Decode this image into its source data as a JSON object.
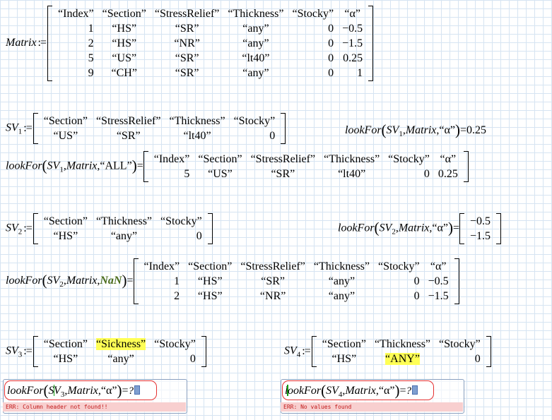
{
  "matrix_def": {
    "name": "Matrix",
    "rows": [
      [
        "“Index”",
        "“Section”",
        "“StressRelief”",
        "“Thickness”",
        "“Stocky”",
        "“α”"
      ],
      [
        "1",
        "“HS”",
        "“SR”",
        "“any”",
        "0",
        "−0.5"
      ],
      [
        "2",
        "“HS”",
        "“NR”",
        "“any”",
        "0",
        "−1.5"
      ],
      [
        "5",
        "“US”",
        "“SR”",
        "“lt40”",
        "0",
        "0.25"
      ],
      [
        "9",
        "“CH”",
        "“SR”",
        "“any”",
        "0",
        "1"
      ]
    ]
  },
  "sv1": {
    "name": "SV",
    "sub": "1",
    "rows": [
      [
        "“Section”",
        "“StressRelief”",
        "“Thickness”",
        "“Stocky”"
      ],
      [
        "“US”",
        "“SR”",
        "“lt40”",
        "0"
      ]
    ],
    "lookup_fn": "lookFor",
    "lookup_args": "Matrix",
    "lookup_key": "“α”",
    "lookup_result": "0.25"
  },
  "sv1_all": {
    "fn": "lookFor",
    "sv": "SV",
    "sub": "1",
    "mat": "Matrix",
    "key": "“ALL”",
    "rows": [
      [
        "“Index”",
        "“Section”",
        "“StressRelief”",
        "“Thickness”",
        "“Stocky”",
        "“α”"
      ],
      [
        "5",
        "“US”",
        "“SR”",
        "“lt40”",
        "0",
        "0.25"
      ]
    ]
  },
  "sv2": {
    "name": "SV",
    "sub": "2",
    "rows": [
      [
        "“Section”",
        "“Thickness”",
        "“Stocky”"
      ],
      [
        "“HS”",
        "“any”",
        "0"
      ]
    ],
    "lookup_fn": "lookFor",
    "lookup_args": "Matrix",
    "lookup_key": "“α”",
    "lookup_result": [
      "−0.5",
      "−1.5"
    ]
  },
  "sv2_nan": {
    "fn": "lookFor",
    "sv": "SV",
    "sub": "2",
    "mat": "Matrix",
    "key": "NaN",
    "rows": [
      [
        "“Index”",
        "“Section”",
        "“StressRelief”",
        "“Thickness”",
        "“Stocky”",
        "“α”"
      ],
      [
        "1",
        "“HS”",
        "“SR”",
        "“any”",
        "0",
        "−0.5"
      ],
      [
        "2",
        "“HS”",
        "“NR”",
        "“any”",
        "0",
        "−1.5"
      ]
    ]
  },
  "sv3": {
    "name": "SV",
    "sub": "3",
    "rows": [
      [
        "“Section”",
        "“Sickness”",
        "“Stocky”"
      ],
      [
        "“HS”",
        "“any”",
        "0"
      ]
    ],
    "highlight": "“Sickness”"
  },
  "sv4": {
    "name": "SV",
    "sub": "4",
    "rows": [
      [
        "“Section”",
        "“Thickness”",
        "“Stocky”"
      ],
      [
        "“HS”",
        "“ANY”",
        "0"
      ]
    ],
    "highlight": "“ANY”"
  },
  "err3": {
    "fn": "lookFor",
    "sv": "SV",
    "sub": "3",
    "mat": "Matrix",
    "key": "“α”",
    "qmark": "?",
    "message": "ERR: Column header not found!!"
  },
  "err4": {
    "fn": "lookFor",
    "sv": "SV",
    "sub": "4",
    "mat": "Matrix",
    "key": "“α”",
    "qmark": "?",
    "message": "ERR: No values found"
  },
  "colors": {
    "highlight": "#ffff55",
    "error_border": "#e53030",
    "error_bar": "#f8cfcf",
    "error_text": "#c01818",
    "grid": "#d6e4f2"
  },
  "symbols": {
    "define": ":=",
    "equals": "="
  }
}
